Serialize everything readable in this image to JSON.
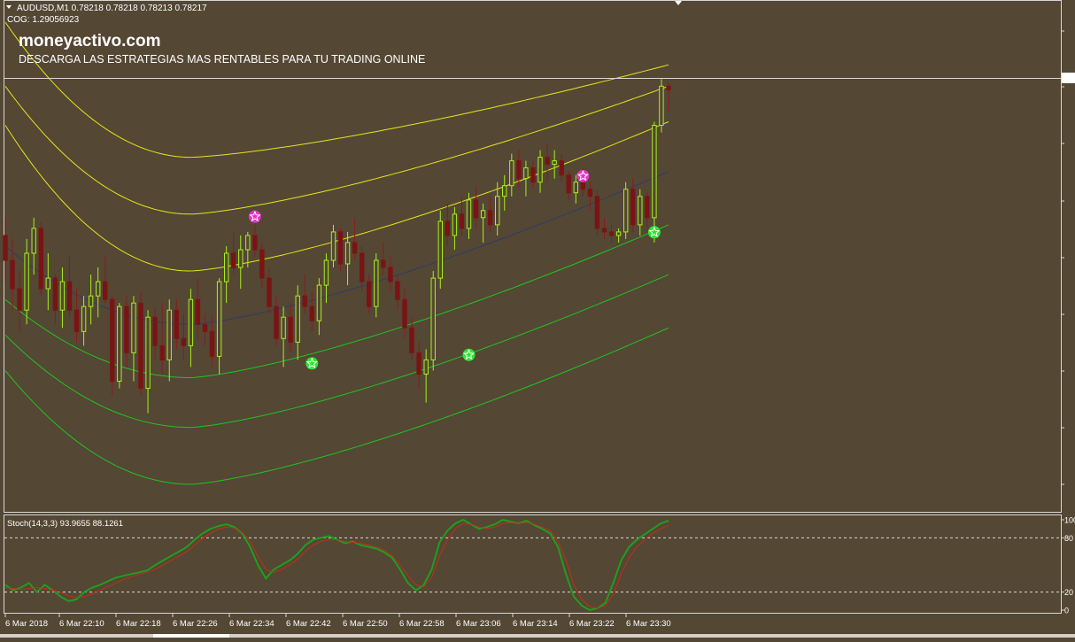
{
  "header": {
    "symbol_line": "AUDUSD,M1  0.78218 0.78218 0.78213 0.78217",
    "indicator_line": "COG: 1.29056923",
    "brand": "moneyactivo.com",
    "tagline": "DESCARGA LAS ESTRATEGIAS MAS RENTABLES PARA TU TRADING ONLINE"
  },
  "colors": {
    "background": "#544734",
    "grid_border": "#d8d8d8",
    "bull_candle": "#a8f01c",
    "bear_candle": "#7a1414",
    "upper_bands": "#e6e619",
    "lower_bands": "#21c421",
    "center_line": "#2e3c6a",
    "sell_signal": "#e633c8",
    "buy_signal": "#2ee62e",
    "stoch_main": "#1f9e1f",
    "stoch_signal": "#c0301a"
  },
  "chart_data": [
    {
      "type": "candlestick",
      "symbol": "AUDUSD",
      "timeframe": "M1",
      "x_tick_labels": [
        "6 Mar 2018",
        "6 Mar 22:10",
        "6 Mar 22:18",
        "6 Mar 22:26",
        "6 Mar 22:34",
        "6 Mar 22:42",
        "6 Mar 22:50",
        "6 Mar 22:58",
        "6 Mar 23:06",
        "6 Mar 23:14",
        "6 Mar 23:22",
        "6 Mar 23:30"
      ],
      "price_axis_note": "price tick labels truncated at right edge",
      "current_price_line": 0.78217,
      "ohlc_rel": [
        [
          0.55,
          0.6,
          0.42,
          0.48
        ],
        [
          0.48,
          0.54,
          0.34,
          0.4
        ],
        [
          0.4,
          0.45,
          0.28,
          0.34
        ],
        [
          0.34,
          0.54,
          0.3,
          0.5
        ],
        [
          0.5,
          0.6,
          0.44,
          0.57
        ],
        [
          0.57,
          0.59,
          0.38,
          0.4
        ],
        [
          0.4,
          0.5,
          0.34,
          0.43
        ],
        [
          0.43,
          0.44,
          0.3,
          0.34
        ],
        [
          0.34,
          0.46,
          0.29,
          0.42
        ],
        [
          0.42,
          0.49,
          0.32,
          0.34
        ],
        [
          0.34,
          0.4,
          0.25,
          0.28
        ],
        [
          0.28,
          0.38,
          0.24,
          0.35
        ],
        [
          0.35,
          0.44,
          0.3,
          0.38
        ],
        [
          0.38,
          0.46,
          0.32,
          0.42
        ],
        [
          0.42,
          0.49,
          0.36,
          0.37
        ],
        [
          0.37,
          0.38,
          0.1,
          0.14
        ],
        [
          0.14,
          0.36,
          0.12,
          0.35
        ],
        [
          0.35,
          0.38,
          0.18,
          0.22
        ],
        [
          0.22,
          0.38,
          0.14,
          0.36
        ],
        [
          0.36,
          0.39,
          0.1,
          0.12
        ],
        [
          0.12,
          0.34,
          0.05,
          0.32
        ],
        [
          0.32,
          0.35,
          0.2,
          0.24
        ],
        [
          0.24,
          0.36,
          0.16,
          0.2
        ],
        [
          0.2,
          0.37,
          0.14,
          0.34
        ],
        [
          0.34,
          0.37,
          0.23,
          0.26
        ],
        [
          0.26,
          0.33,
          0.2,
          0.24
        ],
        [
          0.24,
          0.4,
          0.18,
          0.37
        ],
        [
          0.37,
          0.43,
          0.26,
          0.3
        ],
        [
          0.3,
          0.33,
          0.24,
          0.28
        ],
        [
          0.28,
          0.32,
          0.18,
          0.21
        ],
        [
          0.21,
          0.43,
          0.16,
          0.42
        ],
        [
          0.42,
          0.52,
          0.36,
          0.5
        ],
        [
          0.5,
          0.56,
          0.44,
          0.46
        ],
        [
          0.46,
          0.55,
          0.4,
          0.51
        ],
        [
          0.51,
          0.56,
          0.46,
          0.55
        ],
        [
          0.55,
          0.58,
          0.49,
          0.51
        ],
        [
          0.51,
          0.53,
          0.4,
          0.43
        ],
        [
          0.43,
          0.46,
          0.33,
          0.35
        ],
        [
          0.35,
          0.38,
          0.24,
          0.26
        ],
        [
          0.26,
          0.35,
          0.18,
          0.32
        ],
        [
          0.32,
          0.36,
          0.22,
          0.25
        ],
        [
          0.25,
          0.41,
          0.2,
          0.38
        ],
        [
          0.38,
          0.44,
          0.33,
          0.35
        ],
        [
          0.35,
          0.39,
          0.28,
          0.31
        ],
        [
          0.31,
          0.43,
          0.27,
          0.41
        ],
        [
          0.41,
          0.5,
          0.36,
          0.48
        ],
        [
          0.48,
          0.58,
          0.46,
          0.56
        ],
        [
          0.56,
          0.57,
          0.45,
          0.47
        ],
        [
          0.47,
          0.56,
          0.41,
          0.53
        ],
        [
          0.53,
          0.6,
          0.48,
          0.5
        ],
        [
          0.5,
          0.52,
          0.39,
          0.42
        ],
        [
          0.42,
          0.44,
          0.33,
          0.35
        ],
        [
          0.35,
          0.5,
          0.32,
          0.48
        ],
        [
          0.48,
          0.53,
          0.44,
          0.46
        ],
        [
          0.46,
          0.49,
          0.39,
          0.42
        ],
        [
          0.42,
          0.44,
          0.34,
          0.37
        ],
        [
          0.37,
          0.4,
          0.26,
          0.29
        ],
        [
          0.29,
          0.32,
          0.2,
          0.22
        ],
        [
          0.22,
          0.25,
          0.12,
          0.16
        ],
        [
          0.16,
          0.23,
          0.08,
          0.2
        ],
        [
          0.2,
          0.45,
          0.17,
          0.43
        ],
        [
          0.43,
          0.62,
          0.4,
          0.59
        ],
        [
          0.59,
          0.64,
          0.52,
          0.55
        ],
        [
          0.55,
          0.63,
          0.51,
          0.61
        ],
        [
          0.61,
          0.66,
          0.55,
          0.57
        ],
        [
          0.57,
          0.67,
          0.54,
          0.65
        ],
        [
          0.65,
          0.69,
          0.57,
          0.6
        ],
        [
          0.6,
          0.64,
          0.53,
          0.62
        ],
        [
          0.62,
          0.66,
          0.56,
          0.58
        ],
        [
          0.58,
          0.7,
          0.55,
          0.66
        ],
        [
          0.66,
          0.72,
          0.62,
          0.69
        ],
        [
          0.69,
          0.78,
          0.66,
          0.76
        ],
        [
          0.76,
          0.79,
          0.68,
          0.71
        ],
        [
          0.71,
          0.76,
          0.66,
          0.74
        ],
        [
          0.74,
          0.76,
          0.68,
          0.7
        ],
        [
          0.7,
          0.79,
          0.67,
          0.77
        ],
        [
          0.77,
          0.81,
          0.7,
          0.75
        ],
        [
          0.75,
          0.79,
          0.71,
          0.76
        ],
        [
          0.76,
          0.78,
          0.7,
          0.72
        ],
        [
          0.72,
          0.73,
          0.65,
          0.67
        ],
        [
          0.67,
          0.72,
          0.64,
          0.7
        ],
        [
          0.7,
          0.74,
          0.66,
          0.68
        ],
        [
          0.68,
          0.7,
          0.62,
          0.66
        ],
        [
          0.66,
          0.68,
          0.55,
          0.57
        ],
        [
          0.57,
          0.6,
          0.54,
          0.56
        ],
        [
          0.56,
          0.58,
          0.53,
          0.55
        ],
        [
          0.55,
          0.57,
          0.53,
          0.56
        ],
        [
          0.56,
          0.7,
          0.54,
          0.68
        ],
        [
          0.68,
          0.71,
          0.56,
          0.58
        ],
        [
          0.58,
          0.68,
          0.55,
          0.66
        ],
        [
          0.66,
          0.67,
          0.57,
          0.6
        ],
        [
          0.6,
          0.87,
          0.53,
          0.86
        ],
        [
          0.86,
          0.99,
          0.84,
          0.97
        ],
        [
          0.97,
          0.98,
          0.9,
          0.96
        ]
      ],
      "bands_rel": {
        "center": {
          "start": 0.52,
          "min": 0.3,
          "min_at": 0.28,
          "end": 0.73
        },
        "upper": [
          {
            "start": 1.15,
            "min": 0.77,
            "end": 1.03
          },
          {
            "start": 0.97,
            "min": 0.61,
            "end": 0.97
          },
          {
            "start": 0.86,
            "min": 0.45,
            "end": 0.87
          }
        ],
        "lower": [
          {
            "start": 0.37,
            "min": 0.15,
            "end": 0.58
          },
          {
            "start": 0.27,
            "min": 0.01,
            "end": 0.44
          },
          {
            "start": 0.17,
            "min": -0.15,
            "end": 0.29
          }
        ]
      },
      "signals": [
        {
          "type": "sell",
          "bar": 35,
          "rel": 0.603
        },
        {
          "type": "buy",
          "bar": 43,
          "rel": 0.19
        },
        {
          "type": "buy",
          "bar": 65,
          "rel": 0.214
        },
        {
          "type": "sell",
          "bar": 81,
          "rel": 0.717
        },
        {
          "type": "buy",
          "bar": 91,
          "rel": 0.559
        }
      ]
    },
    {
      "type": "line",
      "title": "Stoch(14,3,3) 93.9655 88.1261",
      "ylim": [
        0,
        100
      ],
      "levels": [
        20,
        80
      ],
      "y_tick_labels": [
        "100",
        "80",
        "20",
        "0"
      ],
      "series": [
        {
          "name": "main",
          "values": [
            28,
            22,
            25,
            30,
            20,
            28,
            22,
            15,
            10,
            12,
            20,
            25,
            28,
            32,
            36,
            38,
            40,
            42,
            44,
            50,
            55,
            60,
            65,
            70,
            78,
            85,
            90,
            93,
            95,
            92,
            85,
            70,
            50,
            35,
            45,
            50,
            55,
            62,
            72,
            78,
            80,
            82,
            78,
            74,
            76,
            72,
            70,
            68,
            64,
            58,
            45,
            30,
            22,
            28,
            45,
            75,
            88,
            96,
            100,
            95,
            90,
            92,
            95,
            100,
            98,
            96,
            99,
            94,
            90,
            85,
            70,
            40,
            15,
            5,
            0,
            2,
            8,
            30,
            55,
            70,
            78,
            84,
            90,
            96,
            99
          ]
        },
        {
          "name": "signal",
          "values": [
            25,
            24,
            23,
            24,
            25,
            24,
            22,
            20,
            16,
            14,
            15,
            18,
            22,
            26,
            30,
            34,
            37,
            40,
            42,
            45,
            50,
            55,
            60,
            65,
            72,
            80,
            85,
            90,
            92,
            91,
            86,
            76,
            60,
            45,
            42,
            45,
            50,
            56,
            65,
            72,
            76,
            78,
            78,
            76,
            75,
            74,
            72,
            70,
            66,
            60,
            50,
            38,
            28,
            26,
            36,
            60,
            78,
            90,
            96,
            95,
            92,
            90,
            92,
            96,
            97,
            96,
            97,
            95,
            92,
            88,
            76,
            55,
            28,
            12,
            4,
            2,
            5,
            18,
            40,
            58,
            70,
            78,
            85,
            90,
            94
          ]
        }
      ]
    }
  ]
}
